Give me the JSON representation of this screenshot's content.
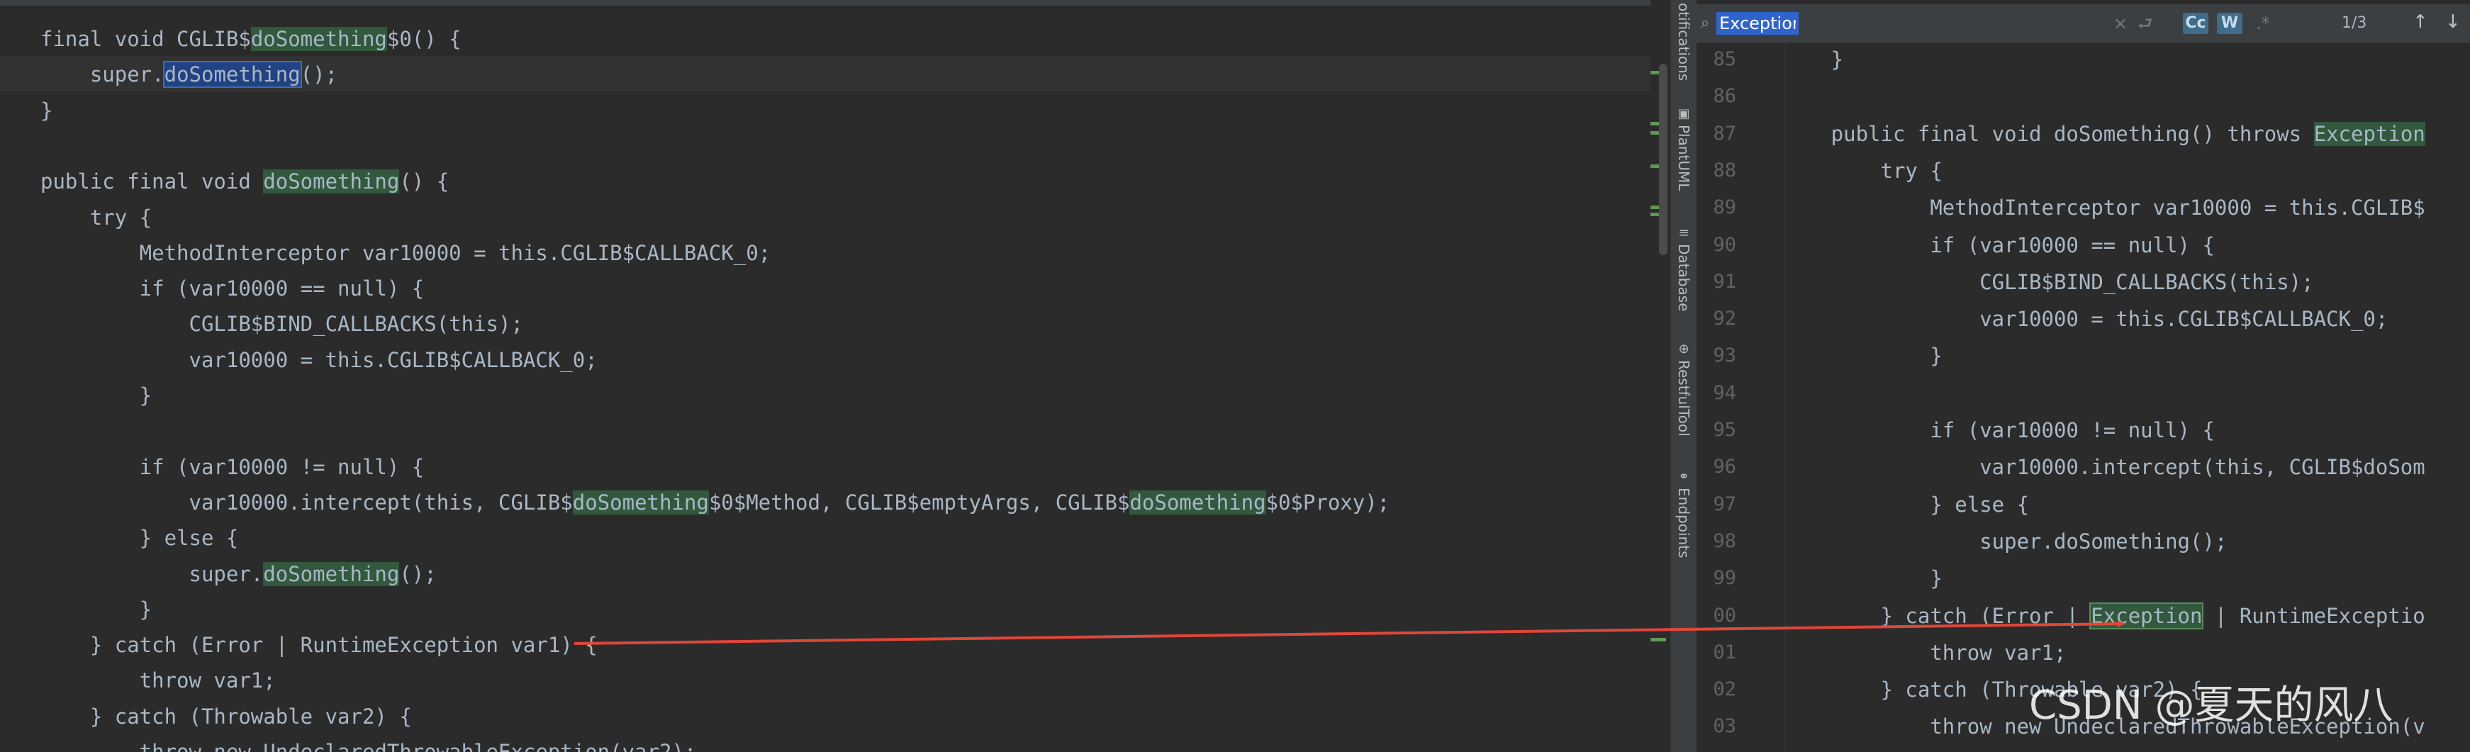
{
  "left_editor": {
    "lines": [
      {
        "segments": [
          {
            "t": "final void CGLIB$"
          },
          {
            "t": "doSomething",
            "k": "hl"
          },
          {
            "t": "$0() {"
          }
        ]
      },
      {
        "segments": [
          {
            "t": "    super."
          },
          {
            "t": "doSomething",
            "k": "hl-sel"
          },
          {
            "t": "();"
          }
        ],
        "current": true
      },
      {
        "segments": [
          {
            "t": "}"
          }
        ]
      },
      {
        "segments": [
          {
            "t": ""
          }
        ]
      },
      {
        "segments": [
          {
            "t": "public final void "
          },
          {
            "t": "doSomething",
            "k": "hl"
          },
          {
            "t": "() {"
          }
        ]
      },
      {
        "segments": [
          {
            "t": "    try {"
          }
        ]
      },
      {
        "segments": [
          {
            "t": "        MethodInterceptor var10000 = this.CGLIB$CALLBACK_0;"
          }
        ]
      },
      {
        "segments": [
          {
            "t": "        if (var10000 == null) {"
          }
        ]
      },
      {
        "segments": [
          {
            "t": "            CGLIB$BIND_CALLBACKS(this);"
          }
        ]
      },
      {
        "segments": [
          {
            "t": "            var10000 = this.CGLIB$CALLBACK_0;"
          }
        ]
      },
      {
        "segments": [
          {
            "t": "        }"
          }
        ]
      },
      {
        "segments": [
          {
            "t": ""
          }
        ]
      },
      {
        "segments": [
          {
            "t": "        if (var10000 != null) {"
          }
        ]
      },
      {
        "segments": [
          {
            "t": "            var10000.intercept(this, CGLIB$"
          },
          {
            "t": "doSomething",
            "k": "hl"
          },
          {
            "t": "$0$Method, CGLIB$emptyArgs, CGLIB$"
          },
          {
            "t": "doSomething",
            "k": "hl"
          },
          {
            "t": "$0$Proxy);"
          }
        ]
      },
      {
        "segments": [
          {
            "t": "        } else {"
          }
        ]
      },
      {
        "segments": [
          {
            "t": "            super."
          },
          {
            "t": "doSomething",
            "k": "hl"
          },
          {
            "t": "();"
          }
        ]
      },
      {
        "segments": [
          {
            "t": "        }"
          }
        ]
      },
      {
        "segments": [
          {
            "t": "    } catch (Error | RuntimeException var1) {"
          }
        ]
      },
      {
        "segments": [
          {
            "t": "        throw var1;"
          }
        ]
      },
      {
        "segments": [
          {
            "t": "    } catch (Throwable var2) {"
          }
        ]
      },
      {
        "segments": [
          {
            "t": "        throw new UndeclaredThrowableException(var2);"
          }
        ]
      }
    ]
  },
  "side_panel": {
    "tabs": [
      {
        "label": "otifications",
        "icon": ""
      },
      {
        "label": "PlantUML",
        "icon": "▣"
      },
      {
        "label": "Database",
        "icon": "≡"
      },
      {
        "label": "RestfulTool",
        "icon": "⊕"
      },
      {
        "label": "Endpoints",
        "icon": "⚭"
      }
    ]
  },
  "search": {
    "query": "Exception",
    "match_case_label": "Cc",
    "words_label": "W",
    "regex_label": ".*",
    "match_count": "1/3",
    "clear_icon": "×",
    "history_icon": "⮐",
    "prev_icon": "↑",
    "next_icon": "↓"
  },
  "right_editor": {
    "line_numbers": [
      "85",
      "86",
      "87",
      "88",
      "89",
      "90",
      "91",
      "92",
      "93",
      "94",
      "95",
      "96",
      "97",
      "98",
      "99",
      "00",
      "01",
      "02",
      "03"
    ],
    "lines": [
      {
        "segments": [
          {
            "t": "        }"
          }
        ]
      },
      {
        "segments": [
          {
            "t": ""
          }
        ]
      },
      {
        "segments": [
          {
            "t": "        public final void doSomething() throws "
          },
          {
            "t": "Exception",
            "k": "hl"
          }
        ]
      },
      {
        "segments": [
          {
            "t": "            try {"
          }
        ]
      },
      {
        "segments": [
          {
            "t": "                MethodInterceptor var10000 = this.CGLIB$"
          }
        ]
      },
      {
        "segments": [
          {
            "t": "                if (var10000 == null) {"
          }
        ]
      },
      {
        "segments": [
          {
            "t": "                    CGLIB$BIND_CALLBACKS(this);"
          }
        ]
      },
      {
        "segments": [
          {
            "t": "                    var10000 = this.CGLIB$CALLBACK_0;"
          }
        ]
      },
      {
        "segments": [
          {
            "t": "                }"
          }
        ]
      },
      {
        "segments": [
          {
            "t": ""
          }
        ]
      },
      {
        "segments": [
          {
            "t": "                if (var10000 != null) {"
          }
        ]
      },
      {
        "segments": [
          {
            "t": "                    var10000.intercept(this, CGLIB$doSom"
          }
        ]
      },
      {
        "segments": [
          {
            "t": "                } else {"
          }
        ]
      },
      {
        "segments": [
          {
            "t": "                    super.doSomething();"
          }
        ]
      },
      {
        "segments": [
          {
            "t": "                }"
          }
        ]
      },
      {
        "segments": [
          {
            "t": "            } catch (Error | "
          },
          {
            "t": "Exception",
            "k": "hl-box"
          },
          {
            "t": " | RuntimeExceptio"
          }
        ]
      },
      {
        "segments": [
          {
            "t": "                throw var1;"
          }
        ]
      },
      {
        "segments": [
          {
            "t": "            } catch (Throwable var2) {"
          }
        ]
      },
      {
        "segments": [
          {
            "t": "                throw new UndeclaredThrowableException(v"
          }
        ]
      }
    ]
  },
  "watermark": "CSDN @夏天的风八",
  "colors": {
    "background": "#2b2b2b",
    "code_text": "#a9b7c6",
    "match_highlight": "#32593d",
    "selection": "#214283",
    "arrow": "#e0473a",
    "search_selection": "#2f65ca"
  }
}
